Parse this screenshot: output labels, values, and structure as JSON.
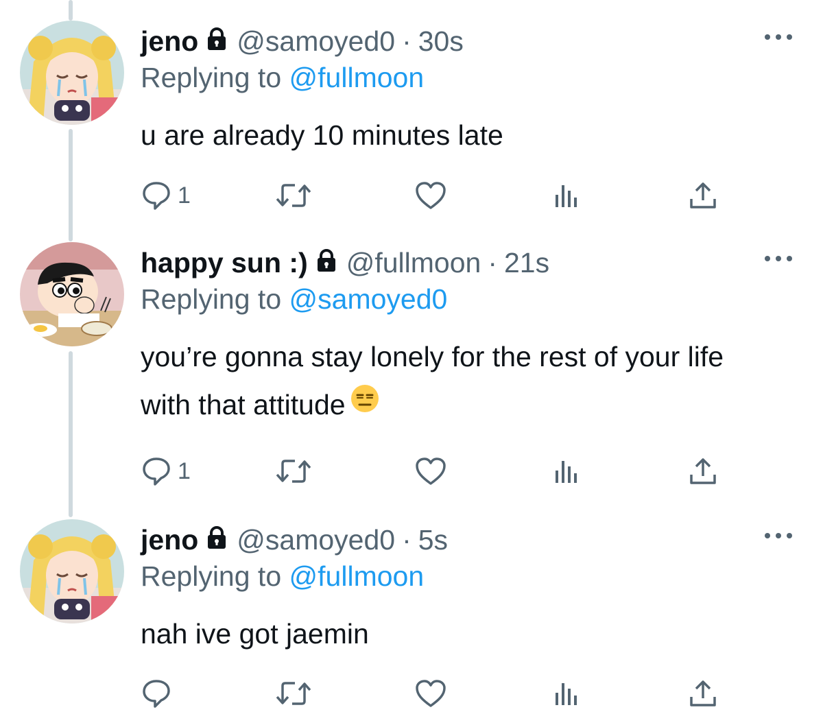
{
  "colors": {
    "text": "#0f1419",
    "secondary": "#536471",
    "link": "#1d9bf0",
    "thread_line": "#cfd9de"
  },
  "tweets": [
    {
      "display_name": "jeno",
      "handle": "@samoyed0",
      "separator": "·",
      "time": "30s",
      "replying_prefix": "Replying to",
      "replying_to": "@fullmoon",
      "text": "u are already 10 minutes late",
      "reply_count": "1",
      "avatar": "sailor-moon-crying-avatar",
      "locked": true
    },
    {
      "display_name": "happy sun :)",
      "handle": "@fullmoon",
      "separator": "·",
      "time": "21s",
      "replying_prefix": "Replying to",
      "replying_to": "@samoyed0",
      "text": "you’re gonna stay lonely for the rest of your life with that attitude",
      "emoji": "expressionless-face-emoji",
      "reply_count": "1",
      "avatar": "shin-chan-eating-avatar",
      "locked": true
    },
    {
      "display_name": "jeno",
      "handle": "@samoyed0",
      "separator": "·",
      "time": "5s",
      "replying_prefix": "Replying to",
      "replying_to": "@fullmoon",
      "text": "nah ive got jaemin",
      "reply_count": "",
      "avatar": "sailor-moon-crying-avatar",
      "locked": true
    }
  ],
  "icons": {
    "reply": "reply-bubble-icon",
    "retweet": "retweet-icon",
    "like": "heart-icon",
    "analytics": "analytics-bars-icon",
    "share": "share-upload-icon",
    "more": "more-dots-icon",
    "lock": "lock-icon"
  }
}
